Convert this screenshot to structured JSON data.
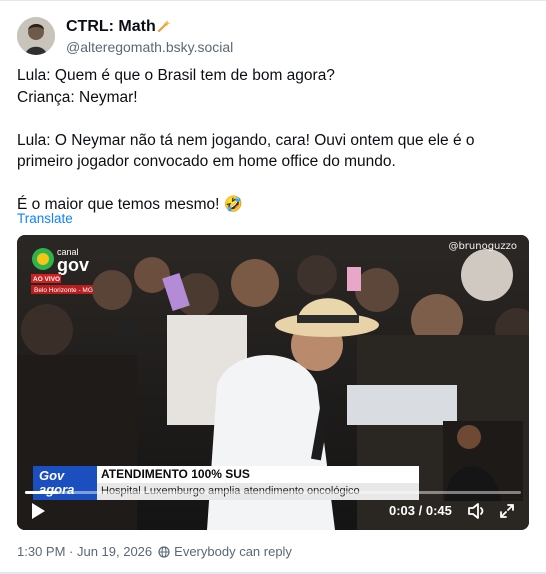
{
  "post": {
    "author": {
      "display_name": "CTRL: Math",
      "handle": "@alteregomath.bsky.social",
      "badge_icon": "sparkle-icon"
    },
    "text_lines": [
      "Lula: Quem é que o Brasil tem de bom agora?",
      "Criança: Neymar!",
      "Lula: O Neymar não tá nem jogando, cara! Ouvi ontem que ele é o primeiro jogador convocado em home office do mundo.",
      "É o maior que temos mesmo! 🤣"
    ],
    "translate_label": "Translate",
    "timestamp": "1:30 PM · Jun 19, 2026",
    "reply_setting": "Everybody can reply"
  },
  "video": {
    "channel_label_top": "canal",
    "channel_label_main": "gov",
    "live_label": "AO VIVO",
    "location": "Belo Horizonte - MG",
    "watermark": "@brunoguzzo",
    "lower_third_logo": [
      "Gov",
      "agora"
    ],
    "headline": "ATENDIMENTO 100% SUS",
    "subheadline": "Hospital Luxemburgo amplia atendimento oncológico",
    "time_display": "0:03 / 0:45",
    "progress_fraction": 0.067
  },
  "colors": {
    "link": "#1083fe",
    "muted": "#5b6876",
    "border": "#e3e8ee"
  }
}
